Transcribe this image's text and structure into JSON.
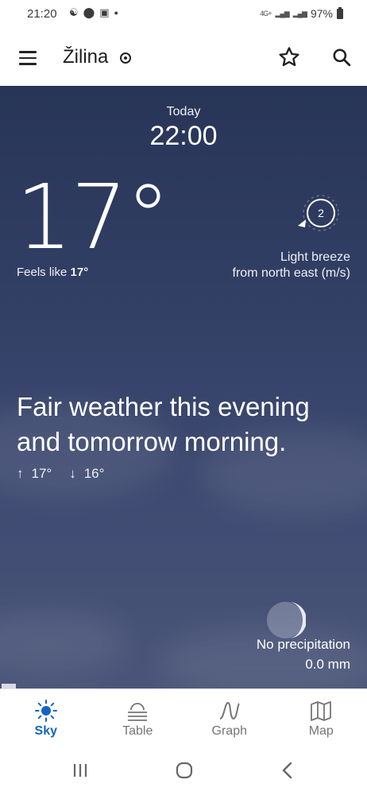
{
  "status_bar": {
    "time": "21:20",
    "network": "4G+",
    "battery": "97%"
  },
  "app_bar": {
    "location": "Žilina",
    "icons": [
      "menu-icon",
      "gps-icon",
      "star-icon",
      "search-icon"
    ]
  },
  "forecast": {
    "period_label": "Today",
    "time": "22:00",
    "temperature": "17°",
    "feels_like_label": "Feels like",
    "feels_like_value": "17°",
    "wind_speed": "2",
    "wind_line1": "Light breeze",
    "wind_line2": "from north east (m/s)",
    "summary": "Fair weather this evening and tomorrow morning.",
    "high": "17°",
    "low": "16°",
    "precip_label": "No precipitation",
    "precip_value": "0.0 mm"
  },
  "bottom_nav": {
    "items": [
      {
        "label": "Sky",
        "icon": "sun-icon",
        "active": true
      },
      {
        "label": "Table",
        "icon": "table-icon",
        "active": false
      },
      {
        "label": "Graph",
        "icon": "graph-icon",
        "active": false
      },
      {
        "label": "Map",
        "icon": "map-icon",
        "active": false
      }
    ]
  },
  "colors": {
    "sky_top": "#283557",
    "sky_bottom": "#4a5578",
    "accent": "#1565c0",
    "inactive": "#757575"
  }
}
